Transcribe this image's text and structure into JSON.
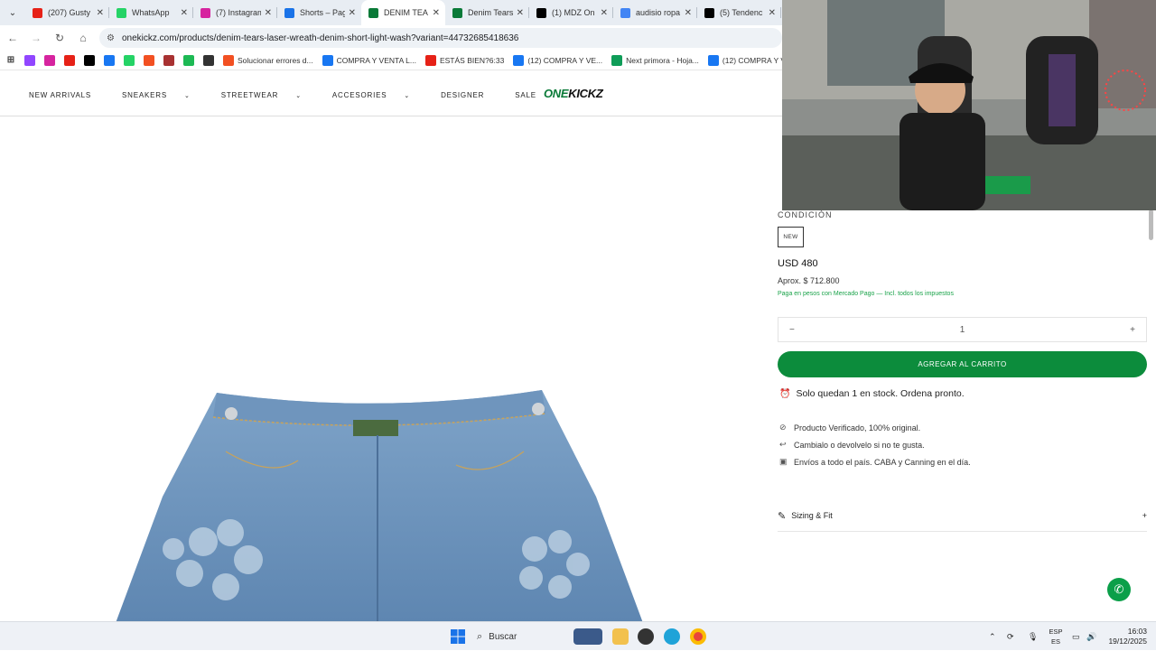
{
  "browser": {
    "tabs": [
      {
        "title": "(207) Gusty",
        "icon": "youtube-icon",
        "color": "#e62117"
      },
      {
        "title": "WhatsApp",
        "icon": "whatsapp-icon",
        "color": "#25d366"
      },
      {
        "title": "(7) Instagram",
        "icon": "instagram-icon",
        "color": "#d6249f"
      },
      {
        "title": "Shorts – Pag",
        "icon": "shorts-icon",
        "color": "#1a73e8"
      },
      {
        "title": "DENIM TEA",
        "icon": "onekickz-icon",
        "color": "#0a7a38"
      },
      {
        "title": "Denim Tears",
        "icon": "onekickz-icon",
        "color": "#0a7a38"
      },
      {
        "title": "(1) MDZ On",
        "icon": "x-icon",
        "color": "#000000"
      },
      {
        "title": "audisio ropa",
        "icon": "google-icon",
        "color": "#4285f4"
      },
      {
        "title": "(5) Tendenc",
        "icon": "x-icon",
        "color": "#000000"
      }
    ],
    "url": "onekickz.com/products/denim-tears-laser-wreath-denim-short-light-wash?variant=44732685418636",
    "bookmarks": [
      {
        "label": "",
        "icon": "twitch-icon",
        "color": "#9146ff"
      },
      {
        "label": "",
        "icon": "instagram-icon",
        "color": "#d6249f"
      },
      {
        "label": "",
        "icon": "youtube-icon",
        "color": "#e62117"
      },
      {
        "label": "",
        "icon": "x-icon",
        "color": "#000000"
      },
      {
        "label": "",
        "icon": "facebook-icon",
        "color": "#1877f2"
      },
      {
        "label": "",
        "icon": "whatsapp-icon",
        "color": "#25d366"
      },
      {
        "label": "",
        "icon": "microsoft-icon",
        "color": "#f25022"
      },
      {
        "label": "",
        "icon": "app-icon",
        "color": "#a83232"
      },
      {
        "label": "",
        "icon": "chat-icon",
        "color": "#1db954"
      },
      {
        "label": "",
        "icon": "globe-icon",
        "color": "#333333"
      },
      {
        "label": "Solucionar errores d...",
        "icon": "microsoft-icon",
        "color": "#f25022"
      },
      {
        "label": "COMPRA Y VENTA L...",
        "icon": "facebook-icon",
        "color": "#1877f2"
      },
      {
        "label": "ESTÁS BIEN?6:33",
        "icon": "youtube-icon",
        "color": "#e62117"
      },
      {
        "label": "(12) COMPRA Y VE...",
        "icon": "facebook-icon",
        "color": "#1877f2"
      },
      {
        "label": "Next primora - Hoja...",
        "icon": "sheets-icon",
        "color": "#0f9d58"
      },
      {
        "label": "(12) COMPRA Y VE...",
        "icon": "facebook-icon",
        "color": "#1877f2"
      }
    ]
  },
  "site": {
    "nav": [
      {
        "label": "NEW ARRIVALS",
        "caret": false
      },
      {
        "label": "SNEAKERS",
        "caret": true
      },
      {
        "label": "STREETWEAR",
        "caret": true
      },
      {
        "label": "ACCESORIES",
        "caret": true
      },
      {
        "label": "DESIGNER",
        "caret": false
      },
      {
        "label": "SALE",
        "caret": false
      }
    ],
    "logo_part1": "ONE",
    "logo_part2": "KICKZ"
  },
  "product": {
    "condition_label": "CONDICIÓN",
    "condition_value": "NEW",
    "price": "USD 480",
    "approx": "Aprox. $ 712.800",
    "payment_note": "Paga en pesos con Mercado Pago — Incl. todos los impuestos",
    "quantity": "1",
    "minus": "−",
    "plus": "+",
    "add_to_cart": "AGREGAR AL CARRITO",
    "stock_message": "Solo quedan 1 en stock. Ordena pronto.",
    "features": [
      {
        "text": "Producto Verificado, 100% original.",
        "icon": "check-circle-icon"
      },
      {
        "text": "Cambialo o devolvelo si no te gusta.",
        "icon": "return-icon"
      },
      {
        "text": "Envíos a todo el país. CABA y Canning en el día.",
        "icon": "box-icon"
      }
    ],
    "sizing_label": "Sizing & Fit",
    "sizing_toggle": "+"
  },
  "taskbar": {
    "search_placeholder": "Buscar",
    "lang_top": "ESP",
    "lang_bottom": "ES",
    "time": "16:03",
    "date": "19/12/2025"
  }
}
